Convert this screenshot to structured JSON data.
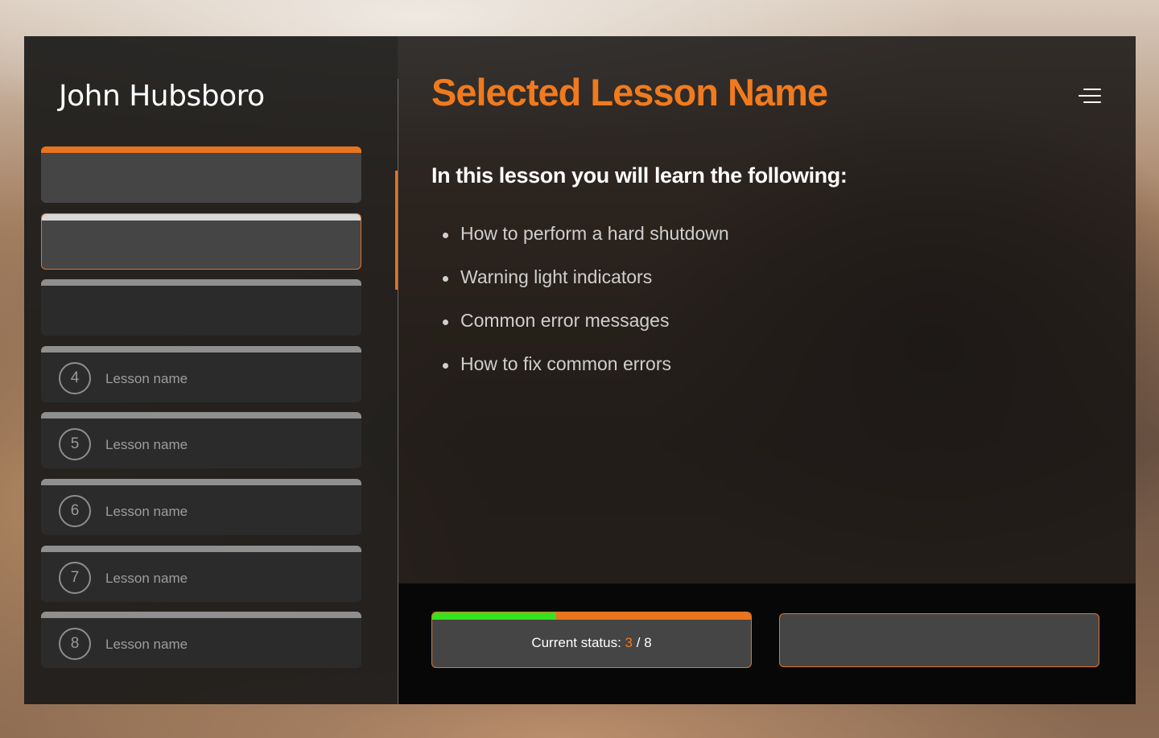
{
  "user": {
    "name": "John Hubsboro"
  },
  "lessons": [
    {
      "number": "",
      "name": "",
      "state": "completed"
    },
    {
      "number": "",
      "name": "",
      "state": "selected"
    },
    {
      "number": "",
      "name": "",
      "state": "default"
    },
    {
      "number": "4",
      "name": "Lesson name",
      "state": "default"
    },
    {
      "number": "5",
      "name": "Lesson name",
      "state": "default"
    },
    {
      "number": "6",
      "name": "Lesson name",
      "state": "default"
    },
    {
      "number": "7",
      "name": "Lesson name",
      "state": "default"
    },
    {
      "number": "8",
      "name": "Lesson name",
      "state": "default"
    }
  ],
  "main": {
    "title": "Selected Lesson Name",
    "subtitle": "In this lesson you will learn the following:",
    "bullets": [
      "How to perform a hard shutdown",
      "Warning light indicators",
      "Common error messages",
      "How to fix common errors"
    ]
  },
  "status": {
    "label": "Current status:",
    "current": "3",
    "separator": "/",
    "total": "8",
    "progress_fraction": 0.39
  },
  "colors": {
    "accent": "#e8741e",
    "progress_complete": "#35e321",
    "title": "#f07a1e"
  },
  "icons": {
    "menu": "menu-icon"
  }
}
